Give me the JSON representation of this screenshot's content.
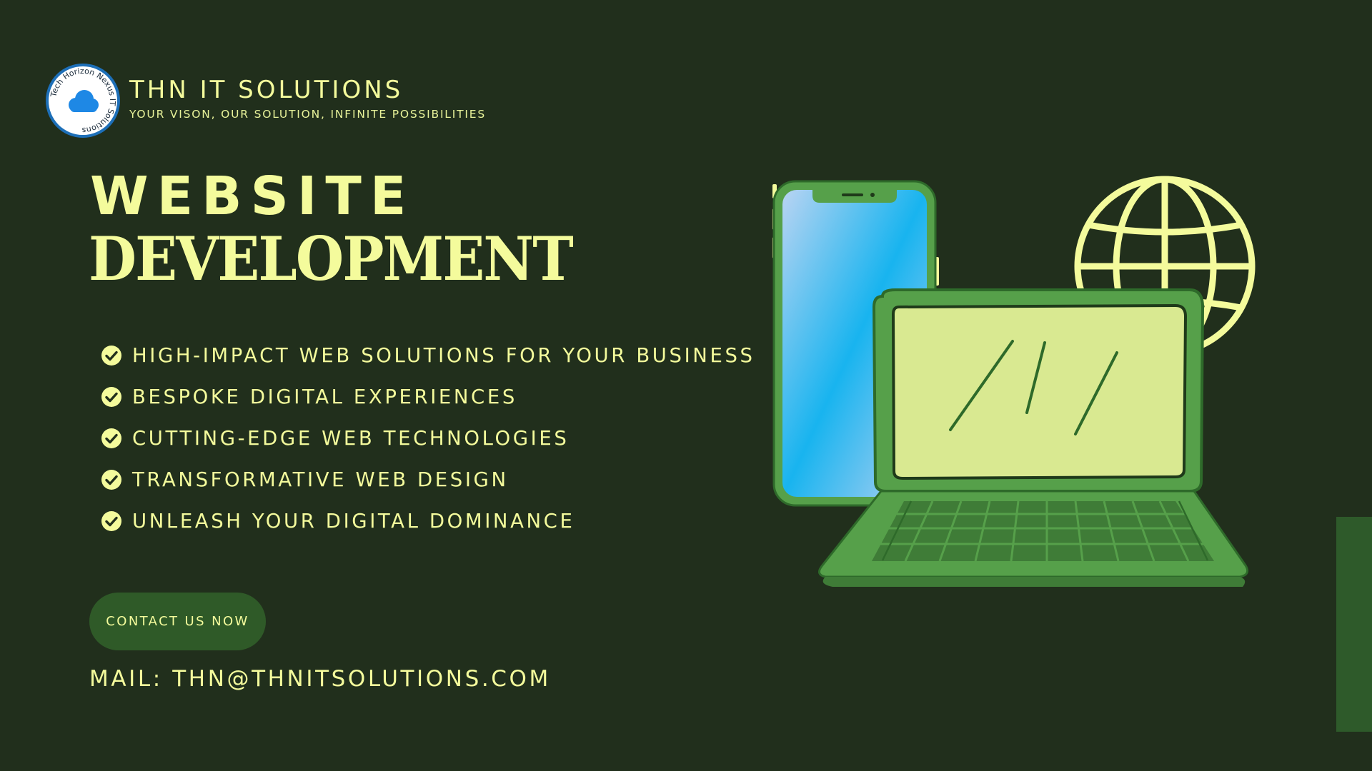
{
  "brand": {
    "logo_ring_text": "Tech Horizon Nexus IT Solutions",
    "name": "THN IT SOLUTIONS",
    "tagline": "YOUR VISON, OUR SOLUTION, INFINITE POSSIBILITIES"
  },
  "hero": {
    "line1": "WEBSITE",
    "line2": "DEVELOPMENT"
  },
  "features": [
    "HIGH-IMPACT WEB SOLUTIONS FOR YOUR BUSINESS",
    "BESPOKE DIGITAL EXPERIENCES",
    "CUTTING-EDGE WEB TECHNOLOGIES",
    "TRANSFORMATIVE WEB DESIGN",
    "UNLEASH YOUR DIGITAL DOMINANCE"
  ],
  "cta": {
    "label": "CONTACT US NOW"
  },
  "contact": {
    "mail": "MAIL: THN@THNITSOLUTIONS.COM"
  },
  "icons": [
    "logo-badge-icon",
    "check-circle-icon",
    "smartphone-icon",
    "globe-icon",
    "laptop-icon"
  ],
  "colors": {
    "background": "#212f1c",
    "text": "#f4fb9c",
    "button": "#2f5a28",
    "device_green": "#56a04a",
    "screen_light": "#d9e991",
    "phone_screen": "#1eb4ee"
  }
}
